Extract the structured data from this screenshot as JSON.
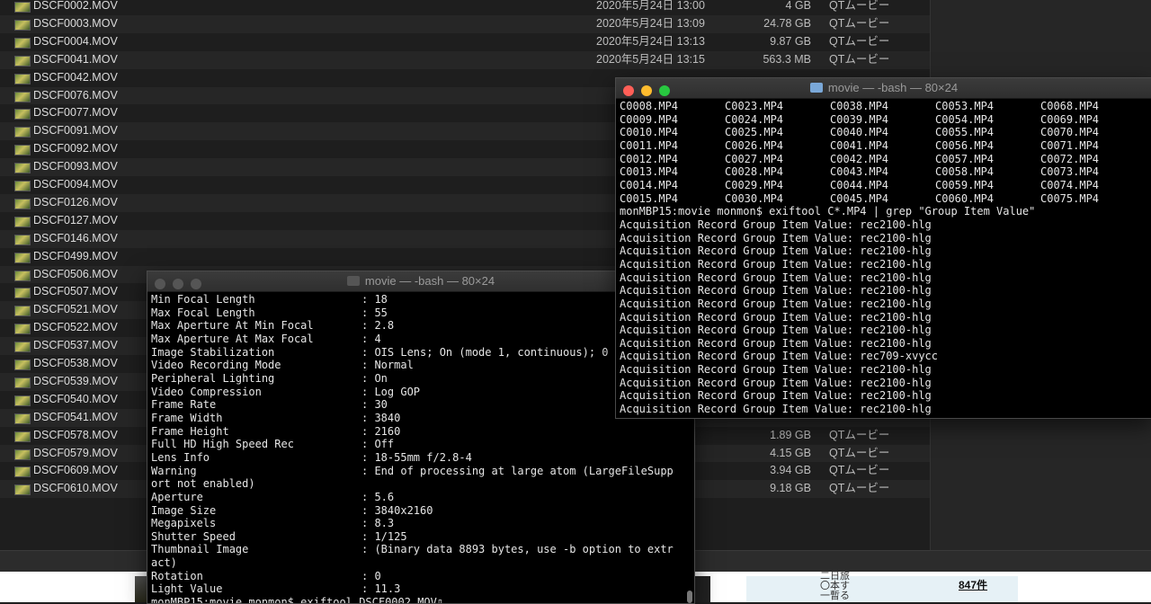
{
  "finder": {
    "rows": [
      {
        "name": "DSCF0002.MOV",
        "date": "2020年5月24日 13:00",
        "size": "4 GB",
        "kind": "QTムービー"
      },
      {
        "name": "DSCF0003.MOV",
        "date": "2020年5月24日 13:09",
        "size": "24.78 GB",
        "kind": "QTムービー"
      },
      {
        "name": "DSCF0004.MOV",
        "date": "2020年5月24日 13:13",
        "size": "9.87 GB",
        "kind": "QTムービー"
      },
      {
        "name": "DSCF0041.MOV",
        "date": "2020年5月24日 13:15",
        "size": "563.3 MB",
        "kind": "QTムービー"
      },
      {
        "name": "DSCF0042.MOV",
        "date": "",
        "size": "",
        "kind": ""
      },
      {
        "name": "DSCF0076.MOV",
        "date": "",
        "size": "",
        "kind": ""
      },
      {
        "name": "DSCF0077.MOV",
        "date": "",
        "size": "",
        "kind": ""
      },
      {
        "name": "DSCF0091.MOV",
        "date": "",
        "size": "",
        "kind": ""
      },
      {
        "name": "DSCF0092.MOV",
        "date": "",
        "size": "",
        "kind": ""
      },
      {
        "name": "DSCF0093.MOV",
        "date": "",
        "size": "",
        "kind": ""
      },
      {
        "name": "DSCF0094.MOV",
        "date": "",
        "size": "",
        "kind": ""
      },
      {
        "name": "DSCF0126.MOV",
        "date": "",
        "size": "",
        "kind": ""
      },
      {
        "name": "DSCF0127.MOV",
        "date": "",
        "size": "",
        "kind": ""
      },
      {
        "name": "DSCF0146.MOV",
        "date": "",
        "size": "",
        "kind": ""
      },
      {
        "name": "DSCF0499.MOV",
        "date": "",
        "size": "",
        "kind": ""
      },
      {
        "name": "DSCF0506.MOV",
        "date": "",
        "size": "",
        "kind": ""
      },
      {
        "name": "DSCF0507.MOV",
        "date": "",
        "size": "",
        "kind": ""
      },
      {
        "name": "DSCF0521.MOV",
        "date": "",
        "size": "",
        "kind": ""
      },
      {
        "name": "DSCF0522.MOV",
        "date": "",
        "size": "",
        "kind": ""
      },
      {
        "name": "DSCF0537.MOV",
        "date": "",
        "size": "",
        "kind": ""
      },
      {
        "name": "DSCF0538.MOV",
        "date": "",
        "size": "",
        "kind": ""
      },
      {
        "name": "DSCF0539.MOV",
        "date": "",
        "size": "",
        "kind": ""
      },
      {
        "name": "DSCF0540.MOV",
        "date": "",
        "size": "",
        "kind": ""
      },
      {
        "name": "DSCF0541.MOV",
        "date": "",
        "size": "",
        "kind": ""
      },
      {
        "name": "DSCF0578.MOV",
        "date": "",
        "size": "1.89 GB",
        "kind": "QTムービー"
      },
      {
        "name": "DSCF0579.MOV",
        "date": "",
        "size": "4.15 GB",
        "kind": "QTムービー"
      },
      {
        "name": "DSCF0609.MOV",
        "date": "",
        "size": "3.94 GB",
        "kind": "QTムービー"
      },
      {
        "name": "DSCF0610.MOV",
        "date": "",
        "size": "9.18 GB",
        "kind": "QTムービー"
      }
    ]
  },
  "web_strip": {
    "vertical_text": "二日旅 〇本す 一暫る",
    "count": "847件"
  },
  "term_back": {
    "title": "movie — -bash — 80×24",
    "lines": [
      {
        "k": "Min Focal Length",
        "v": ": 18"
      },
      {
        "k": "Max Focal Length",
        "v": ": 55"
      },
      {
        "k": "Max Aperture At Min Focal",
        "v": ": 2.8"
      },
      {
        "k": "Max Aperture At Max Focal",
        "v": ": 4"
      },
      {
        "k": "Image Stabilization",
        "v": ": OIS Lens; On (mode 1, continuous); 0"
      },
      {
        "k": "Video Recording Mode",
        "v": ": Normal"
      },
      {
        "k": "Peripheral Lighting",
        "v": ": On"
      },
      {
        "k": "Video Compression",
        "v": ": Log GOP"
      },
      {
        "k": "Frame Rate",
        "v": ": 30"
      },
      {
        "k": "Frame Width",
        "v": ": 3840"
      },
      {
        "k": "Frame Height",
        "v": ": 2160"
      },
      {
        "k": "Full HD High Speed Rec",
        "v": ": Off"
      },
      {
        "k": "Lens Info",
        "v": ": 18-55mm f/2.8-4"
      },
      {
        "k": "Warning",
        "v": ": End of processing at large atom (LargeFileSupp"
      },
      {
        "k": "ort not enabled)",
        "v": ""
      },
      {
        "k": "Aperture",
        "v": ": 5.6"
      },
      {
        "k": "Image Size",
        "v": ": 3840x2160"
      },
      {
        "k": "Megapixels",
        "v": ": 8.3"
      },
      {
        "k": "Shutter Speed",
        "v": ": 1/125"
      },
      {
        "k": "Thumbnail Image",
        "v": ": (Binary data 8893 bytes, use -b option to extr"
      },
      {
        "k": "act)",
        "v": ""
      },
      {
        "k": "Rotation",
        "v": ": 0"
      },
      {
        "k": "Light Value",
        "v": ": 11.3"
      }
    ],
    "prompt": "monMBP15:movie monmon$ exiftool DSCF0002.MOV▯"
  },
  "term_front": {
    "title": "movie — -bash — 80×24",
    "file_rows": [
      [
        "C0008.MP4",
        "C0023.MP4",
        "C0038.MP4",
        "C0053.MP4",
        "C0068.MP4"
      ],
      [
        "C0009.MP4",
        "C0024.MP4",
        "C0039.MP4",
        "C0054.MP4",
        "C0069.MP4"
      ],
      [
        "C0010.MP4",
        "C0025.MP4",
        "C0040.MP4",
        "C0055.MP4",
        "C0070.MP4"
      ],
      [
        "C0011.MP4",
        "C0026.MP4",
        "C0041.MP4",
        "C0056.MP4",
        "C0071.MP4"
      ],
      [
        "C0012.MP4",
        "C0027.MP4",
        "C0042.MP4",
        "C0057.MP4",
        "C0072.MP4"
      ],
      [
        "C0013.MP4",
        "C0028.MP4",
        "C0043.MP4",
        "C0058.MP4",
        "C0073.MP4"
      ],
      [
        "C0014.MP4",
        "C0029.MP4",
        "C0044.MP4",
        "C0059.MP4",
        "C0074.MP4"
      ],
      [
        "C0015.MP4",
        "C0030.MP4",
        "C0045.MP4",
        "C0060.MP4",
        "C0075.MP4"
      ]
    ],
    "command": "monMBP15:movie monmon$ exiftool C*.MP4 | grep \"Group Item Value\"",
    "results": [
      "Acquisition Record Group Item Value: rec2100-hlg",
      "Acquisition Record Group Item Value: rec2100-hlg",
      "Acquisition Record Group Item Value: rec2100-hlg",
      "Acquisition Record Group Item Value: rec2100-hlg",
      "Acquisition Record Group Item Value: rec2100-hlg",
      "Acquisition Record Group Item Value: rec2100-hlg",
      "Acquisition Record Group Item Value: rec2100-hlg",
      "Acquisition Record Group Item Value: rec2100-hlg",
      "Acquisition Record Group Item Value: rec2100-hlg",
      "Acquisition Record Group Item Value: rec2100-hlg",
      "Acquisition Record Group Item Value: rec709-xvycc",
      "Acquisition Record Group Item Value: rec2100-hlg",
      "Acquisition Record Group Item Value: rec2100-hlg",
      "Acquisition Record Group Item Value: rec2100-hlg",
      "Acquisition Record Group Item Value: rec2100-hlg"
    ]
  }
}
